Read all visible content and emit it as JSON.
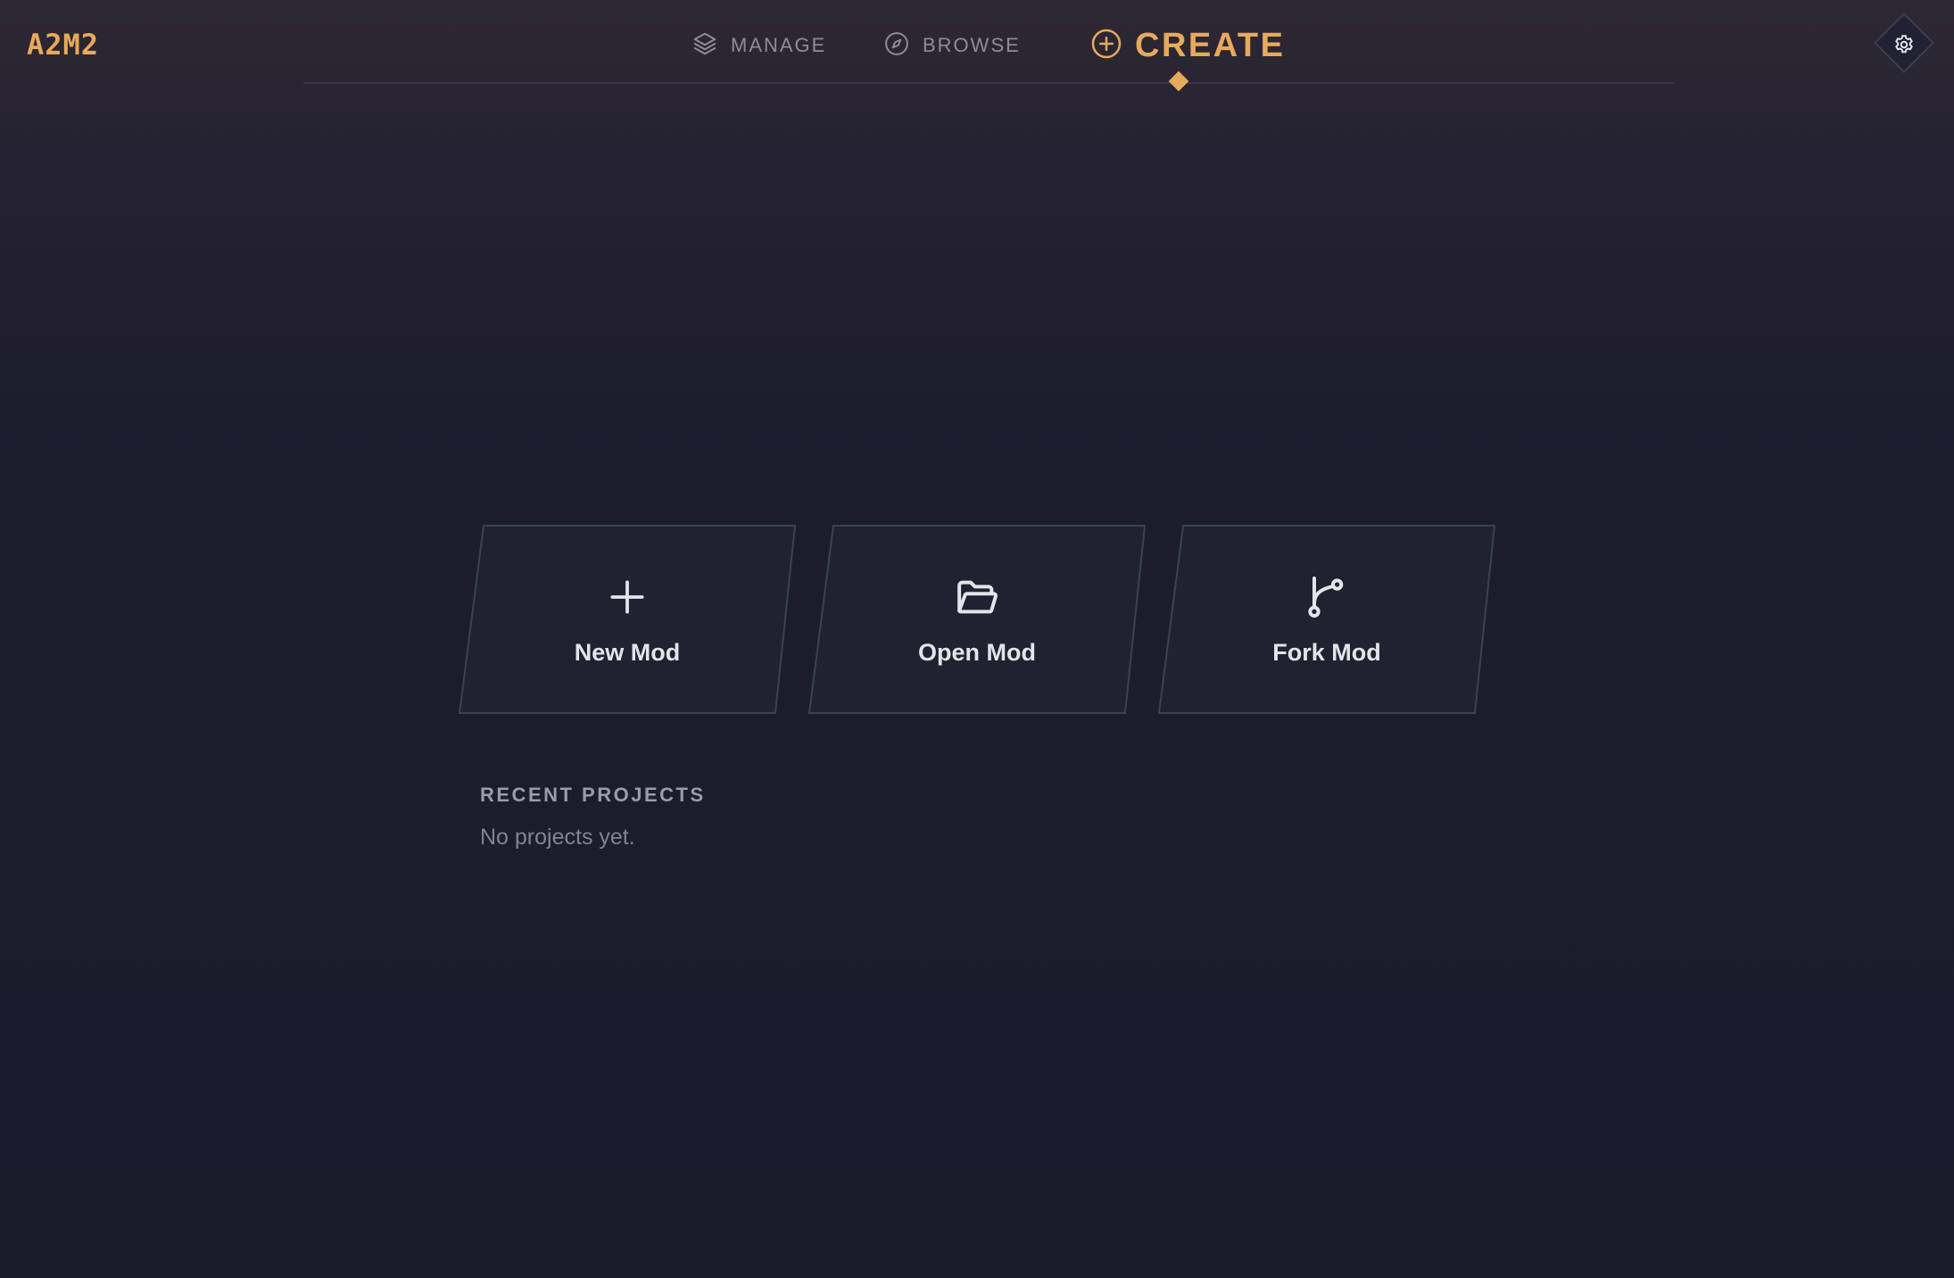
{
  "app": {
    "logo": "A2M2"
  },
  "nav": {
    "items": [
      {
        "label": "MANAGE",
        "icon": "layers-icon"
      },
      {
        "label": "BROWSE",
        "icon": "compass-icon"
      },
      {
        "label": "CREATE",
        "icon": "plus-circle-icon"
      }
    ],
    "active": "CREATE"
  },
  "settings": {
    "icon": "gear-icon"
  },
  "actions": [
    {
      "label": "New Mod",
      "icon": "plus-icon"
    },
    {
      "label": "Open Mod",
      "icon": "folder-open-icon"
    },
    {
      "label": "Fork Mod",
      "icon": "git-fork-icon"
    }
  ],
  "recent": {
    "heading": "RECENT PROJECTS",
    "empty_text": "No projects yet."
  },
  "colors": {
    "accent": "#e8a95c",
    "card_bg": "#1f2331",
    "card_border": "#3d4150",
    "muted_text": "#8e8c99"
  }
}
